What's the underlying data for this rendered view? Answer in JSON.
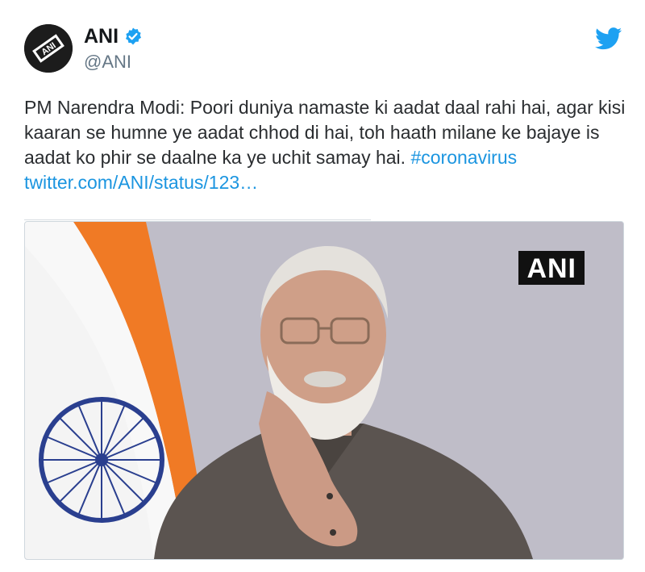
{
  "tweet": {
    "author": {
      "display_name": "ANI",
      "handle": "@ANI",
      "verified": true,
      "avatar_icon": "ani-logo-avatar"
    },
    "brand_icon": "twitter-bird-icon",
    "text": {
      "body": "PM Narendra Modi: Poori duniya namaste ki aadat daal rahi hai, agar kisi kaaran se humne ye aadat chhod di hai, toh haath milane ke bajaye is aadat ko phir se daalne ka ye uchit samay hai. ",
      "hashtag": "#coronavirus",
      "link": "twitter.com/ANI/status/123…"
    },
    "media": {
      "watermark": "ANI"
    }
  },
  "colors": {
    "link": "#1b95e0",
    "verified": "#1da1f2",
    "handle": "#657786"
  }
}
